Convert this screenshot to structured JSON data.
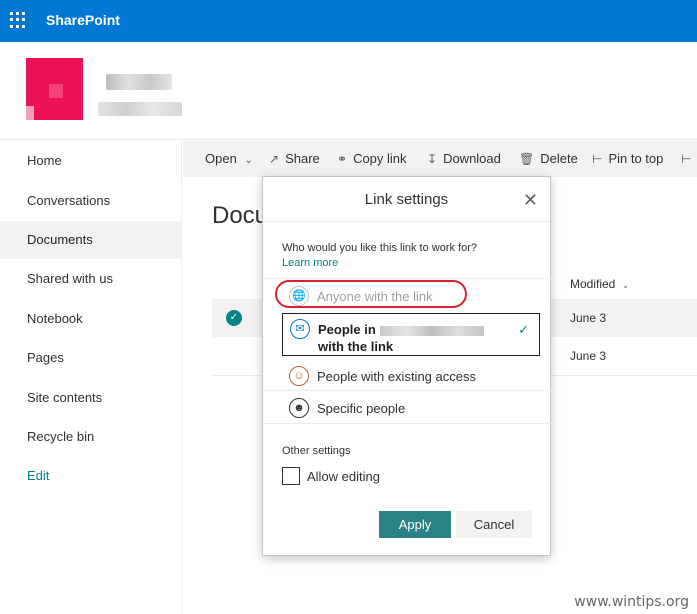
{
  "suite": {
    "title": "SharePoint",
    "waffle_icon": "waffle-icon"
  },
  "nav": {
    "items": [
      {
        "label": "Home"
      },
      {
        "label": "Conversations"
      },
      {
        "label": "Documents"
      },
      {
        "label": "Shared with us"
      },
      {
        "label": "Notebook"
      },
      {
        "label": "Pages"
      },
      {
        "label": "Site contents"
      },
      {
        "label": "Recycle bin"
      }
    ],
    "edit_label": "Edit",
    "active": "Documents"
  },
  "commands": {
    "open": "Open",
    "share": "Share",
    "copy_link": "Copy link",
    "download": "Download",
    "delete": "Delete",
    "pin": "Pin to top"
  },
  "library": {
    "title": "Documents",
    "modified_header": "Modified",
    "rows": [
      {
        "modified": "June 3"
      },
      {
        "modified": "June 3"
      }
    ]
  },
  "dialog": {
    "title": "Link settings",
    "question": "Who would you like this link to work for?",
    "learn_more": "Learn more",
    "options": {
      "anyone": "Anyone with the link",
      "people_in_prefix": "People in",
      "people_in_suffix": "with the link",
      "existing": "People with existing access",
      "specific": "Specific people"
    },
    "other_settings": "Other settings",
    "allow_editing": "Allow editing",
    "apply": "Apply",
    "cancel": "Cancel"
  },
  "watermark": "www.wintips.org",
  "colors": {
    "suitebar": "#0078d4",
    "accent": "#038387",
    "apply": "#2b8285",
    "highlight": "#d8222f",
    "logo": "#ea1155"
  }
}
